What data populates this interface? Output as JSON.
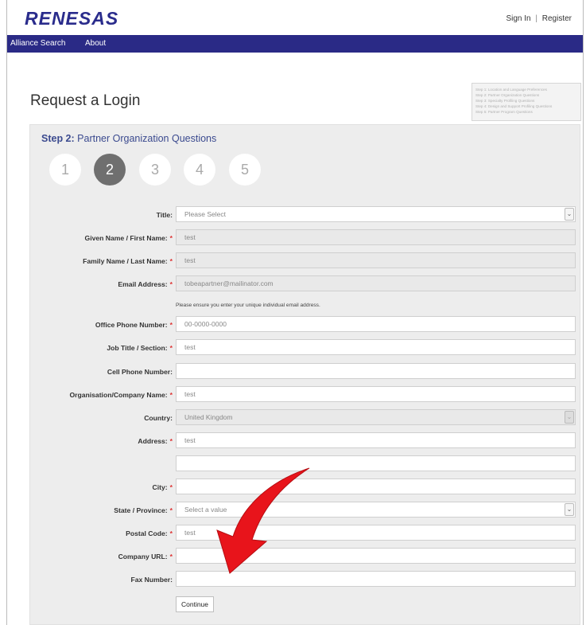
{
  "header": {
    "logo_text": "RENESAS",
    "sign_in": "Sign In",
    "separator": "|",
    "register": "Register"
  },
  "nav": {
    "items": [
      "Alliance Search",
      "About"
    ]
  },
  "page": {
    "title": "Request a Login"
  },
  "steps_summary": [
    "Step 1: Location and Language Preferences",
    "Step 2: Partner Organization Questions",
    "Step 3: Specialty Profiling Questions",
    "Step 4: Design and Support Profiling Questions",
    "Step 5: Partner Program Questions"
  ],
  "wizard": {
    "step_prefix": "Step 2:",
    "step_name": "Partner Organization Questions",
    "steps": [
      "1",
      "2",
      "3",
      "4",
      "5"
    ],
    "active_step": 2
  },
  "form": {
    "title_label": "Title:",
    "title_value": "Please Select",
    "given_name_label": "Given Name / First Name:",
    "given_name_value": "test",
    "family_name_label": "Family Name / Last Name:",
    "family_name_value": "test",
    "email_label": "Email Address:",
    "email_value": "tobeapartner@mailinator.com",
    "email_hint": "Please ensure you enter your unique individual email address.",
    "office_phone_label": "Office Phone Number:",
    "office_phone_value": "00-0000-0000",
    "job_title_label": "Job Title / Section:",
    "job_title_value": "test",
    "cell_phone_label": "Cell Phone Number:",
    "cell_phone_value": "",
    "company_label": "Organisation/Company Name:",
    "company_value": "test",
    "country_label": "Country:",
    "country_value": "United Kingdom",
    "address_label": "Address:",
    "address_value": "test",
    "address2_value": "",
    "city_label": "City:",
    "city_value": "",
    "state_label": "State / Province:",
    "state_value": "Select a value",
    "postal_label": "Postal Code:",
    "postal_value": "test",
    "url_label": "Company URL:",
    "url_value": "",
    "fax_label": "Fax Number:",
    "fax_value": "",
    "required_mark": "*",
    "continue_label": "Continue"
  },
  "annotation": {
    "arrow_color": "#e8141b"
  }
}
